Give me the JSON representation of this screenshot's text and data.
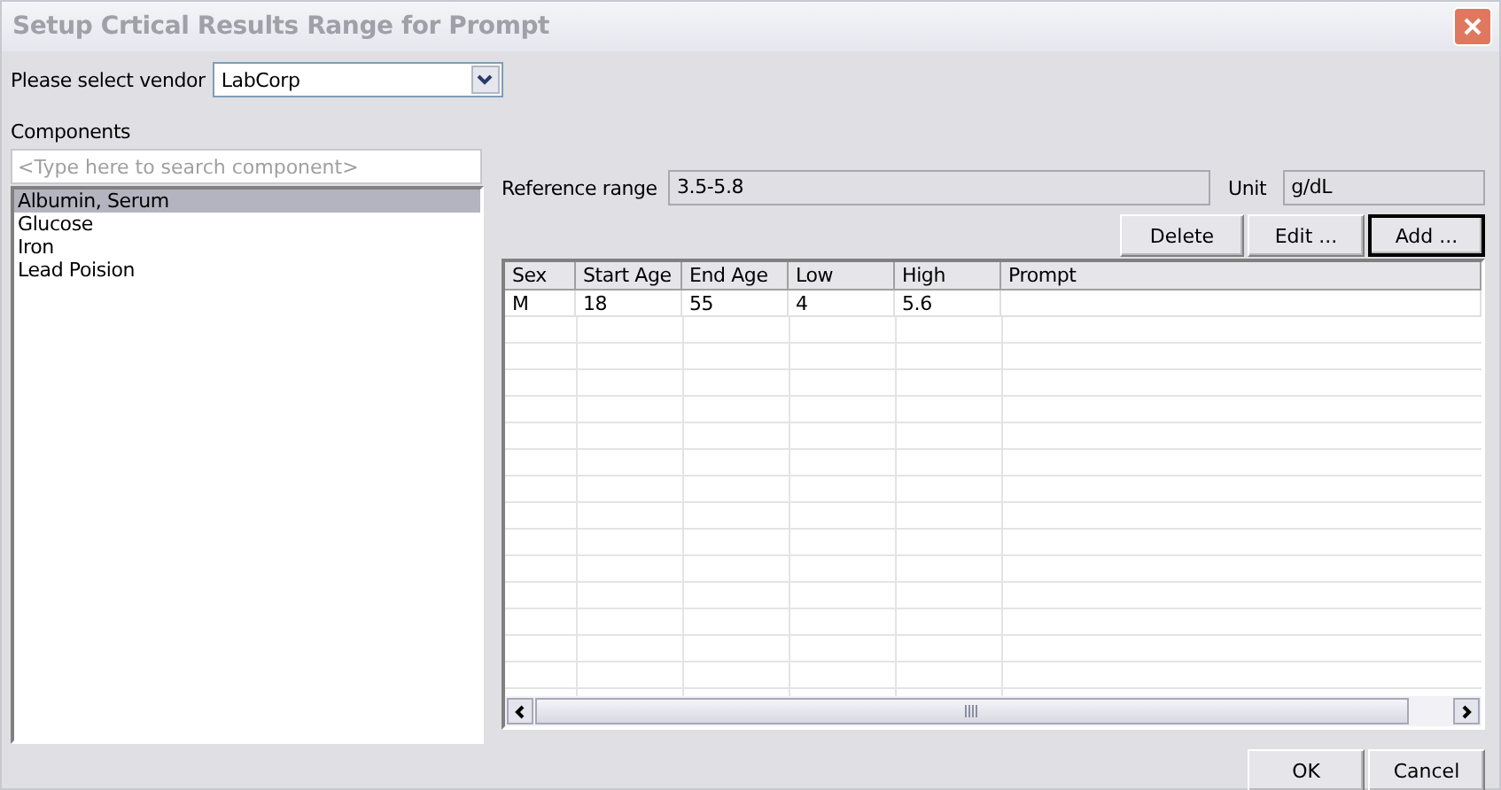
{
  "window": {
    "title": "Setup Crtical Results Range for Prompt"
  },
  "vendor": {
    "label": "Please select vendor",
    "value": "LabCorp"
  },
  "components": {
    "label": "Components",
    "placeholder": "<Type here to search component>",
    "items": [
      {
        "label": "Albumin, Serum",
        "selected": true
      },
      {
        "label": "Glucose",
        "selected": false
      },
      {
        "label": "Iron",
        "selected": false
      },
      {
        "label": "Lead Poision",
        "selected": false
      }
    ]
  },
  "reference_range": {
    "label": "Reference range",
    "value": "3.5-5.8"
  },
  "unit": {
    "label": "Unit",
    "value": "g/dL"
  },
  "actions": [
    {
      "label": "Delete",
      "default": false
    },
    {
      "label": "Edit ...",
      "default": false
    },
    {
      "label": "Add ...",
      "default": true
    }
  ],
  "table": {
    "columns": [
      "Sex",
      "Start Age",
      "End Age",
      "Low",
      "High",
      "Prompt"
    ],
    "rows": [
      [
        "M",
        "18",
        "55",
        "4",
        "5.6",
        ""
      ]
    ]
  },
  "footer_buttons": [
    {
      "label": "OK",
      "default": false
    },
    {
      "label": "Cancel",
      "default": false
    }
  ]
}
